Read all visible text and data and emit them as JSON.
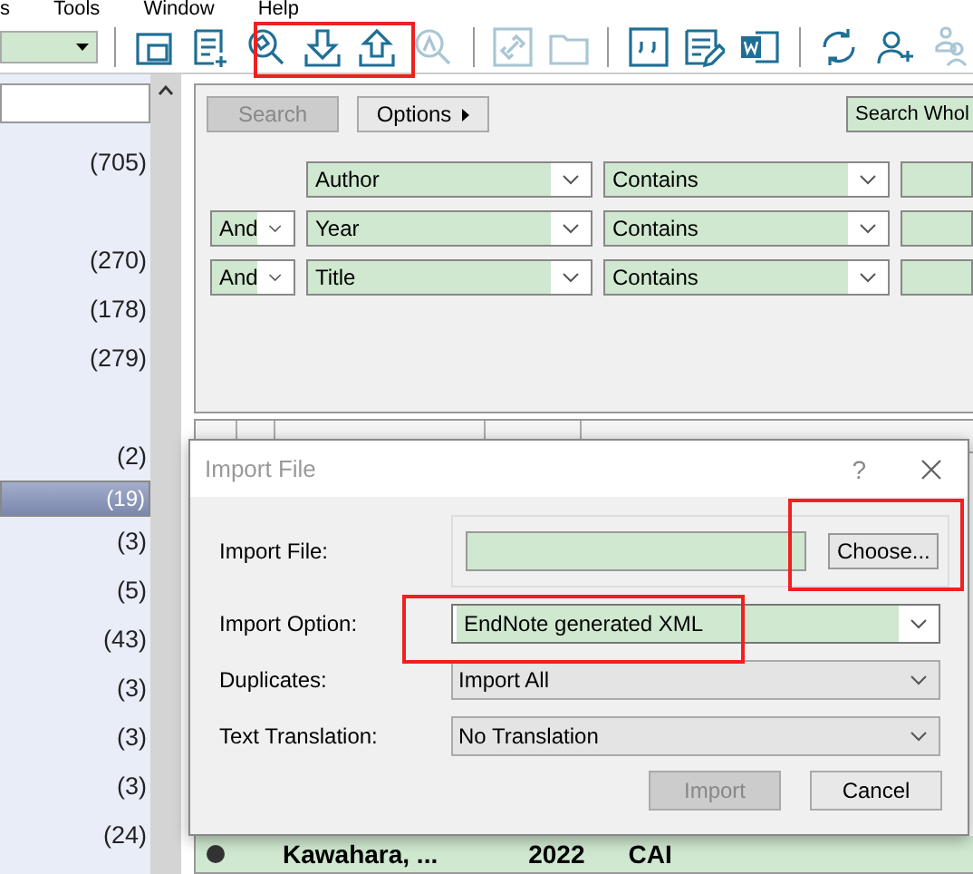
{
  "menu": [
    "s",
    "Tools",
    "Window",
    "Help"
  ],
  "toolbar": {
    "tools": [
      {
        "kind": "windows",
        "disabled": false
      },
      {
        "kind": "new-reference",
        "disabled": false
      },
      {
        "kind": "globe-search",
        "disabled": false
      },
      {
        "kind": "import",
        "disabled": false
      },
      {
        "kind": "export",
        "disabled": false
      },
      {
        "kind": "find-pdf",
        "disabled": true
      },
      {
        "kind": "link",
        "disabled": true
      },
      {
        "kind": "folder",
        "disabled": true
      },
      {
        "kind": "quote",
        "disabled": false
      },
      {
        "kind": "edit",
        "disabled": false
      },
      {
        "kind": "word",
        "disabled": false
      },
      {
        "kind": "sync",
        "disabled": false
      },
      {
        "kind": "add-user",
        "disabled": false
      },
      {
        "kind": "share",
        "disabled": true
      }
    ]
  },
  "groups": [
    {
      "count": "(705)",
      "selected": false
    },
    {
      "count": "(270)",
      "selected": false,
      "gap_before": true
    },
    {
      "count": "(178)",
      "selected": false
    },
    {
      "count": "(279)",
      "selected": false
    },
    {
      "count": "(2)",
      "selected": false,
      "gap_before": true
    },
    {
      "count": "(19)",
      "selected": true
    },
    {
      "count": "(3)",
      "selected": false
    },
    {
      "count": "(5)",
      "selected": false
    },
    {
      "count": "(43)",
      "selected": false
    },
    {
      "count": "(3)",
      "selected": false
    },
    {
      "count": "(3)",
      "selected": false
    },
    {
      "count": "(3)",
      "selected": false
    },
    {
      "count": "(24)",
      "selected": false
    }
  ],
  "search": {
    "buttons": [
      {
        "label": "Search",
        "disabled": true
      },
      {
        "label": "Options",
        "disabled": false
      }
    ],
    "whole_button": "Search Whol",
    "rows": [
      {
        "field": "Author",
        "operator": "Contains"
      },
      {
        "bool": "And",
        "field": "Year",
        "operator": "Contains"
      },
      {
        "bool": "And",
        "field": "Title",
        "operator": "Contains"
      }
    ]
  },
  "table": {
    "rows": [
      {
        "author": "Kawahara, ...",
        "year": "2022",
        "title": "CAI"
      }
    ]
  },
  "dialog": {
    "title": "Import File",
    "help": "?",
    "fields": [
      {
        "kind": "file",
        "label": "Import File:",
        "button": "Choose..."
      },
      {
        "kind": "select",
        "label": "Import Option:",
        "value": "EndNote generated XML",
        "highlighted": true
      },
      {
        "kind": "select",
        "label": "Duplicates:",
        "value": "Import All",
        "highlighted": false
      },
      {
        "kind": "select",
        "label": "Text Translation:",
        "value": "No Translation",
        "highlighted": false
      }
    ],
    "buttons": [
      {
        "label": "Import",
        "disabled": true
      },
      {
        "label": "Cancel",
        "disabled": false
      }
    ]
  },
  "highlights": [
    {
      "kind": "toolbar"
    },
    {
      "kind": "choose"
    },
    {
      "kind": "option"
    }
  ]
}
